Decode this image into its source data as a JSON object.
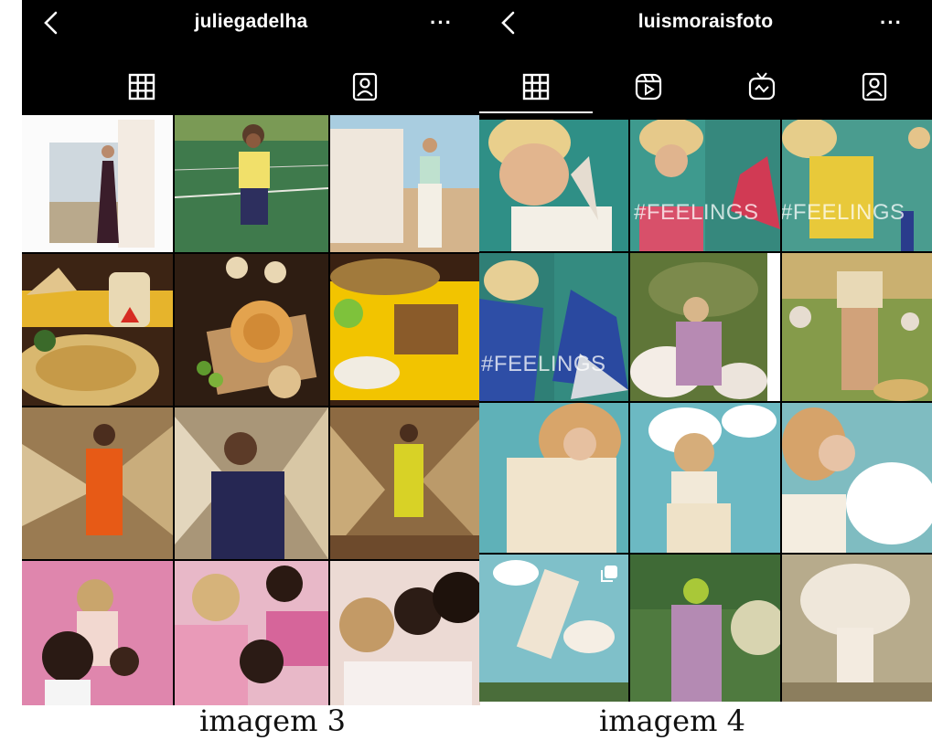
{
  "left": {
    "username": "juliegadelha",
    "more": "···",
    "icons": {
      "back": "chevron-left-icon",
      "grid": "grid-icon",
      "tagged": "tagged-person-icon",
      "more": "more-horizontal-icon"
    },
    "caption": "imagem 3"
  },
  "right": {
    "username": "luismoraisfoto",
    "more": "···",
    "icons": {
      "back": "chevron-left-icon",
      "grid": "grid-icon",
      "reels": "reels-icon",
      "igtv": "igtv-icon",
      "tagged": "tagged-person-icon",
      "multi": "carousel-icon"
    },
    "overlay_texts": [
      "#FEELINGS",
      "#FEELINGS",
      "#FEELINGS"
    ],
    "caption": "imagem 4"
  }
}
